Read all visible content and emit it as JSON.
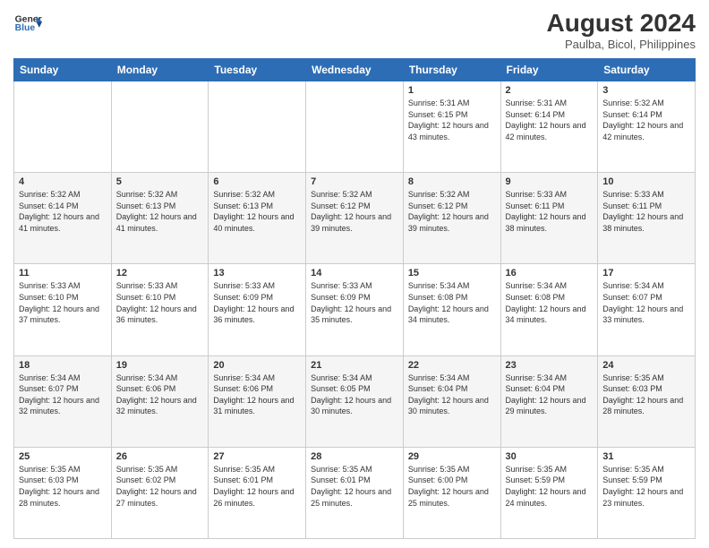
{
  "logo": {
    "line1": "General",
    "line2": "Blue"
  },
  "title": "August 2024",
  "subtitle": "Paulba, Bicol, Philippines",
  "days_of_week": [
    "Sunday",
    "Monday",
    "Tuesday",
    "Wednesday",
    "Thursday",
    "Friday",
    "Saturday"
  ],
  "weeks": [
    [
      {
        "day": "",
        "sunrise": "",
        "sunset": "",
        "daylight": ""
      },
      {
        "day": "",
        "sunrise": "",
        "sunset": "",
        "daylight": ""
      },
      {
        "day": "",
        "sunrise": "",
        "sunset": "",
        "daylight": ""
      },
      {
        "day": "",
        "sunrise": "",
        "sunset": "",
        "daylight": ""
      },
      {
        "day": "1",
        "sunrise": "5:31 AM",
        "sunset": "6:15 PM",
        "daylight": "12 hours and 43 minutes."
      },
      {
        "day": "2",
        "sunrise": "5:31 AM",
        "sunset": "6:14 PM",
        "daylight": "12 hours and 42 minutes."
      },
      {
        "day": "3",
        "sunrise": "5:32 AM",
        "sunset": "6:14 PM",
        "daylight": "12 hours and 42 minutes."
      }
    ],
    [
      {
        "day": "4",
        "sunrise": "5:32 AM",
        "sunset": "6:14 PM",
        "daylight": "12 hours and 41 minutes."
      },
      {
        "day": "5",
        "sunrise": "5:32 AM",
        "sunset": "6:13 PM",
        "daylight": "12 hours and 41 minutes."
      },
      {
        "day": "6",
        "sunrise": "5:32 AM",
        "sunset": "6:13 PM",
        "daylight": "12 hours and 40 minutes."
      },
      {
        "day": "7",
        "sunrise": "5:32 AM",
        "sunset": "6:12 PM",
        "daylight": "12 hours and 39 minutes."
      },
      {
        "day": "8",
        "sunrise": "5:32 AM",
        "sunset": "6:12 PM",
        "daylight": "12 hours and 39 minutes."
      },
      {
        "day": "9",
        "sunrise": "5:33 AM",
        "sunset": "6:11 PM",
        "daylight": "12 hours and 38 minutes."
      },
      {
        "day": "10",
        "sunrise": "5:33 AM",
        "sunset": "6:11 PM",
        "daylight": "12 hours and 38 minutes."
      }
    ],
    [
      {
        "day": "11",
        "sunrise": "5:33 AM",
        "sunset": "6:10 PM",
        "daylight": "12 hours and 37 minutes."
      },
      {
        "day": "12",
        "sunrise": "5:33 AM",
        "sunset": "6:10 PM",
        "daylight": "12 hours and 36 minutes."
      },
      {
        "day": "13",
        "sunrise": "5:33 AM",
        "sunset": "6:09 PM",
        "daylight": "12 hours and 36 minutes."
      },
      {
        "day": "14",
        "sunrise": "5:33 AM",
        "sunset": "6:09 PM",
        "daylight": "12 hours and 35 minutes."
      },
      {
        "day": "15",
        "sunrise": "5:34 AM",
        "sunset": "6:08 PM",
        "daylight": "12 hours and 34 minutes."
      },
      {
        "day": "16",
        "sunrise": "5:34 AM",
        "sunset": "6:08 PM",
        "daylight": "12 hours and 34 minutes."
      },
      {
        "day": "17",
        "sunrise": "5:34 AM",
        "sunset": "6:07 PM",
        "daylight": "12 hours and 33 minutes."
      }
    ],
    [
      {
        "day": "18",
        "sunrise": "5:34 AM",
        "sunset": "6:07 PM",
        "daylight": "12 hours and 32 minutes."
      },
      {
        "day": "19",
        "sunrise": "5:34 AM",
        "sunset": "6:06 PM",
        "daylight": "12 hours and 32 minutes."
      },
      {
        "day": "20",
        "sunrise": "5:34 AM",
        "sunset": "6:06 PM",
        "daylight": "12 hours and 31 minutes."
      },
      {
        "day": "21",
        "sunrise": "5:34 AM",
        "sunset": "6:05 PM",
        "daylight": "12 hours and 30 minutes."
      },
      {
        "day": "22",
        "sunrise": "5:34 AM",
        "sunset": "6:04 PM",
        "daylight": "12 hours and 30 minutes."
      },
      {
        "day": "23",
        "sunrise": "5:34 AM",
        "sunset": "6:04 PM",
        "daylight": "12 hours and 29 minutes."
      },
      {
        "day": "24",
        "sunrise": "5:35 AM",
        "sunset": "6:03 PM",
        "daylight": "12 hours and 28 minutes."
      }
    ],
    [
      {
        "day": "25",
        "sunrise": "5:35 AM",
        "sunset": "6:03 PM",
        "daylight": "12 hours and 28 minutes."
      },
      {
        "day": "26",
        "sunrise": "5:35 AM",
        "sunset": "6:02 PM",
        "daylight": "12 hours and 27 minutes."
      },
      {
        "day": "27",
        "sunrise": "5:35 AM",
        "sunset": "6:01 PM",
        "daylight": "12 hours and 26 minutes."
      },
      {
        "day": "28",
        "sunrise": "5:35 AM",
        "sunset": "6:01 PM",
        "daylight": "12 hours and 25 minutes."
      },
      {
        "day": "29",
        "sunrise": "5:35 AM",
        "sunset": "6:00 PM",
        "daylight": "12 hours and 25 minutes."
      },
      {
        "day": "30",
        "sunrise": "5:35 AM",
        "sunset": "5:59 PM",
        "daylight": "12 hours and 24 minutes."
      },
      {
        "day": "31",
        "sunrise": "5:35 AM",
        "sunset": "5:59 PM",
        "daylight": "12 hours and 23 minutes."
      }
    ]
  ]
}
